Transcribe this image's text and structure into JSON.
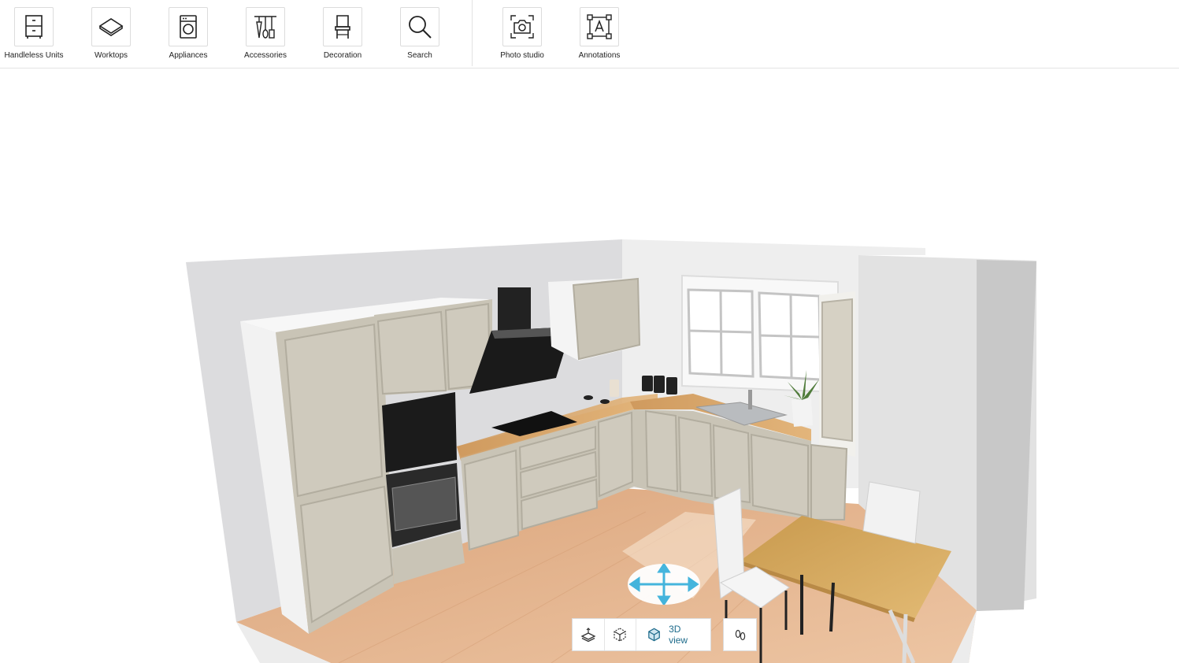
{
  "toolbar": {
    "tools": [
      {
        "label": "Handleless Units",
        "icon": "cabinet-icon"
      },
      {
        "label": "Worktops",
        "icon": "worktop-icon"
      },
      {
        "label": "Appliances",
        "icon": "washing-machine-icon"
      },
      {
        "label": "Accessories",
        "icon": "utensils-icon"
      },
      {
        "label": "Decoration",
        "icon": "chair-icon"
      },
      {
        "label": "Search",
        "icon": "search-icon"
      }
    ],
    "extra_tools": [
      {
        "label": "Photo studio",
        "icon": "camera-icon"
      },
      {
        "label": "Annotations",
        "icon": "annotation-icon"
      }
    ]
  },
  "view_controls": {
    "view_2d_icon": "layers-2d-icon",
    "view_cube_icon": "cube-wireframe-icon",
    "view_3d_label": "3D view",
    "view_3d_icon": "cube-3d-icon",
    "walk_icon": "footsteps-icon"
  },
  "colors": {
    "accent": "#1f6c8c",
    "move_arrows": "#3cb4e0",
    "floor": "#e3b58f",
    "cabinet": "#c9c4b6",
    "worktop": "#d9a66b"
  }
}
